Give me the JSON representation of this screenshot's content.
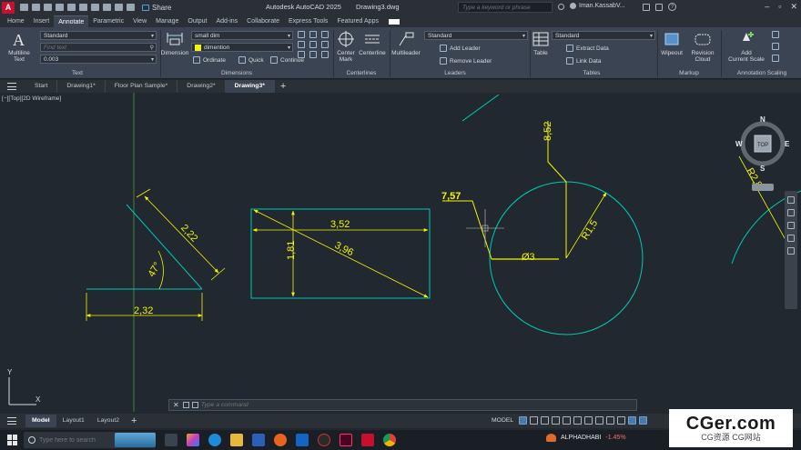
{
  "window": {
    "title_app": "Autodesk AutoCAD 2025",
    "title_file": "Drawing3.dwg",
    "share_label": "Share",
    "search_placeholder": "Type a keyword or phrase",
    "user_name": "Iman.KassabV..."
  },
  "ribbon_tabs": [
    "Home",
    "Insert",
    "Annotate",
    "Parametric",
    "View",
    "Manage",
    "Output",
    "Add-ins",
    "Collaborate",
    "Express Tools",
    "Featured Apps"
  ],
  "ribbon_active_tab": "Annotate",
  "ribbon": {
    "text_panel": {
      "multiline_text": "Multiline",
      "multiline_text_2": "Text",
      "style": "Standard",
      "find_placeholder": "Find text",
      "height": "0.003",
      "label": "Text"
    },
    "dimensions_panel": {
      "dimension_btn": "Dimension",
      "dim_style": "small dim",
      "layer": "dimention",
      "ordinate": "Ordinate",
      "quick": "Quick",
      "continue": "Continue",
      "label": "Dimensions"
    },
    "centerlines_panel": {
      "center_mark": "Center",
      "center_mark_2": "Mark",
      "centerline": "Centerline",
      "label": "Centerlines"
    },
    "leaders_panel": {
      "multileader": "Multileader",
      "style": "Standard",
      "add_leader": "Add Leader",
      "remove_leader": "Remove Leader",
      "label": "Leaders"
    },
    "tables_panel": {
      "table": "Table",
      "style": "Standard",
      "extract_data": "Extract Data",
      "link_data": "Link Data",
      "label": "Tables"
    },
    "markup_panel": {
      "wipeout": "Wipeout",
      "revision_cloud": "Revision",
      "revision_cloud_2": "Cloud",
      "label": "Markup"
    },
    "scaling_panel": {
      "add_scale": "Add",
      "add_scale_2": "Current Scale",
      "label": "Annotation Scaling"
    }
  },
  "file_tabs": [
    "Start",
    "Drawing1*",
    "Floor Plan Sample*",
    "Drawing2*",
    "Drawing3*"
  ],
  "active_file_tab": "Drawing3*",
  "viewport_label": "[−][Top][2D Wireframe]",
  "drawing": {
    "dims": {
      "d_2_22": "2,22",
      "d_47": "47°",
      "d_2_32": "2,32",
      "d_3_52": "3,52",
      "d_1_81": "1,81",
      "d_3_96": "3,96",
      "d_7_57": "7,57",
      "d_8_52": "8,52",
      "d_r1_5": "R1,5",
      "d_dia3": "Ø3",
      "d_r2_8": "R2,8"
    },
    "viewcube": {
      "n": "N",
      "s": "S",
      "e": "E",
      "w": "W",
      "top": "TOP"
    },
    "ucs": {
      "x": "X",
      "y": "Y"
    },
    "colors": {
      "background": "#212830",
      "dimension": "#f5f500",
      "geometry": "#00c8b4",
      "axis": "#4a9d3a"
    }
  },
  "command": {
    "placeholder": "Type a command"
  },
  "layout_tabs": [
    "Model",
    "Layout1",
    "Layout2"
  ],
  "active_layout_tab": "Model",
  "status": {
    "model_label": "MODEL"
  },
  "taskbar": {
    "search_placeholder": "Type here to search",
    "stock_name": "ALPHADHABI",
    "stock_change": "-1.45%"
  },
  "watermark": {
    "main": "CGer.com",
    "sub": "CG资源 CG网站"
  }
}
